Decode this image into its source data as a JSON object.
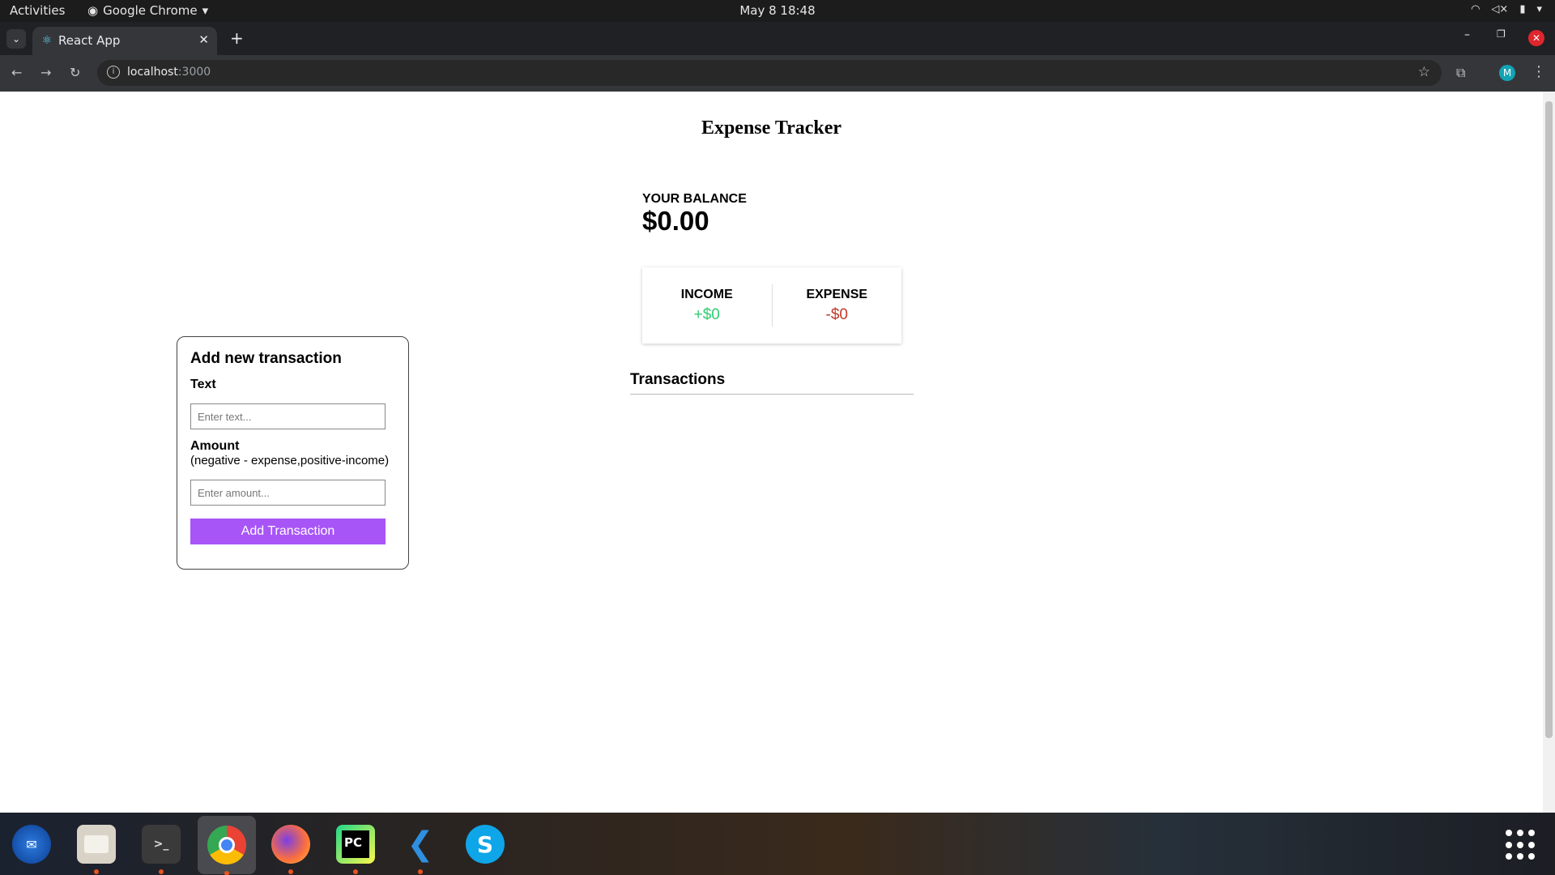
{
  "system_bar": {
    "activities": "Activities",
    "app_name": "Google Chrome",
    "clock": "May 8  18:48"
  },
  "browser": {
    "tab_title": "React App",
    "url_host": "localhost",
    "url_port": ":3000",
    "profile_initial": "M"
  },
  "app": {
    "title": "Expense Tracker",
    "balance_label": "YOUR BALANCE",
    "balance_value": "$0.00",
    "income_label": "INCOME",
    "income_value": "+$0",
    "expense_label": "EXPENSE",
    "expense_value": "-$0",
    "transactions_heading": "Transactions"
  },
  "form": {
    "heading": "Add new transaction",
    "text_label": "Text",
    "text_placeholder": "Enter text...",
    "amount_label": "Amount",
    "amount_hint": "(negative - expense,positive-income)",
    "amount_placeholder": "Enter amount...",
    "submit_label": "Add Transaction"
  },
  "colors": {
    "income": "#2ecc71",
    "expense": "#c0392b",
    "button": "#a855f7"
  },
  "dock": {
    "apps": [
      "thunderbird-icon",
      "files-icon",
      "terminal-icon",
      "chrome-icon",
      "firefox-icon",
      "pycharm-icon",
      "vscode-icon",
      "skype-icon",
      "app-grid-icon"
    ]
  }
}
